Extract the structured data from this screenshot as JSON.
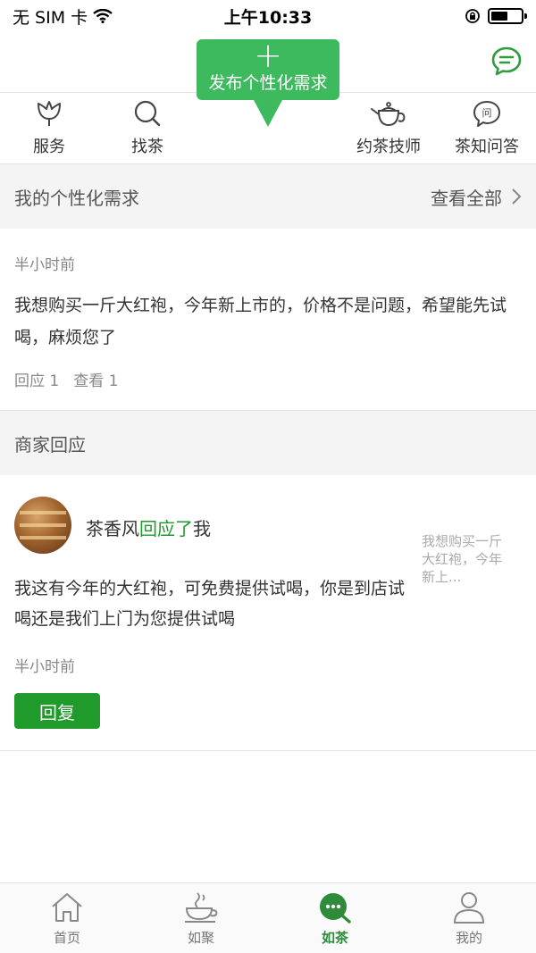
{
  "status_bar": {
    "carrier": "无 SIM 卡",
    "time": "上午10:33",
    "battery_level": 0.55
  },
  "publish": {
    "label": "发布个性化需求",
    "plus": "+"
  },
  "quick_nav": [
    {
      "label": "服务",
      "icon": "tulip-icon"
    },
    {
      "label": "找茶",
      "icon": "search-icon"
    },
    {
      "label": "约茶技师",
      "icon": "teapot-icon"
    },
    {
      "label": "茶知问答",
      "icon": "question-bubble-icon"
    }
  ],
  "my_requests": {
    "title": "我的个性化需求",
    "view_all": "查看全部",
    "item": {
      "time": "半小时前",
      "text": "我想购买一斤大红袍，今年新上市的，价格不是问题，希望能先试喝，麻烦您了",
      "reply_count": "回应 1",
      "view_count": "查看 1"
    }
  },
  "responses": {
    "title": "商家回应",
    "item": {
      "merchant": "茶香风",
      "action": "回应了",
      "target": "我",
      "quote": "我想购买一斤大红袍，今年新上...",
      "text": "我这有今年的大红袍，可免费提供试喝，你是到店试喝还是我们上门为您提供试喝",
      "time": "半小时前",
      "reply_button": "回复"
    }
  },
  "tabs": [
    {
      "label": "首页",
      "icon": "home-icon",
      "active": false
    },
    {
      "label": "如聚",
      "icon": "tea-cup-icon",
      "active": false
    },
    {
      "label": "如茶",
      "icon": "chat-dots-icon",
      "active": true
    },
    {
      "label": "我的",
      "icon": "user-icon",
      "active": false
    }
  ],
  "colors": {
    "accent": "#3dba5e",
    "accent_dark": "#1f9a2b",
    "section_bg": "#f4f4f4"
  }
}
